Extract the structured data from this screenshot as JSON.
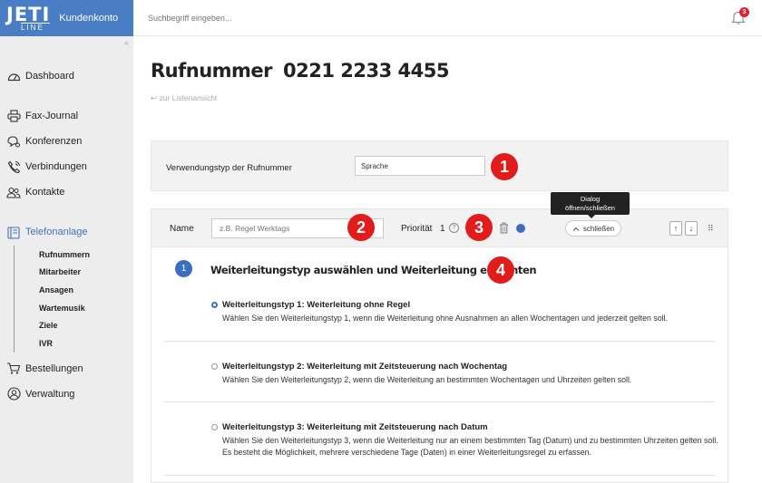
{
  "brand": {
    "logo_main": "JETI",
    "logo_sub": "LINE",
    "title": "Kundenkonto"
  },
  "search": {
    "placeholder": "Suchbegriff eingeben..."
  },
  "notifications": {
    "count": "3"
  },
  "nav": {
    "items": [
      {
        "label": "Dashboard",
        "icon": "dashboard-icon"
      },
      {
        "label": "Fax-Journal",
        "icon": "printer-icon"
      },
      {
        "label": "Konferenzen",
        "icon": "conference-icon"
      },
      {
        "label": "Verbindungen",
        "icon": "phone-icon"
      },
      {
        "label": "Kontakte",
        "icon": "contacts-icon"
      },
      {
        "label": "Telefonanlage",
        "icon": "pbx-icon"
      },
      {
        "label": "Bestellungen",
        "icon": "cart-icon"
      },
      {
        "label": "Verwaltung",
        "icon": "user-icon"
      }
    ],
    "sub_items": [
      "Rufnummern",
      "Mitarbeiter",
      "Ansagen",
      "Wartemusik",
      "Ziele",
      "IVR"
    ]
  },
  "page": {
    "title": "Rufnummer",
    "number": "0221 2233 4455",
    "back_link": "zur Listenansicht"
  },
  "usage": {
    "label": "Verwendungstyp der Rufnummer",
    "value": "Sprache"
  },
  "rule": {
    "name_label": "Name",
    "name_placeholder": "z.B. Regel Werktags",
    "priority_label": "Priorität",
    "priority_value": "1",
    "close_label": "schließen",
    "tooltip_line1": "Dialog",
    "tooltip_line2": "öffnen/schließen"
  },
  "markers": [
    "1",
    "2",
    "3",
    "4"
  ],
  "step": {
    "number": "1",
    "title": "Weiterleitungstyp auswählen und Weiterleitung einrichten"
  },
  "options": [
    {
      "title": "Weiterleitungstyp 1: Weiterleitung ohne Regel",
      "desc": "Wählen Sie den Weiterleitungstyp 1, wenn die Weiterleitung ohne Ausnahmen an allen Wochentagen und jederzeit gelten soll.",
      "selected": true
    },
    {
      "title": "Weiterleitungstyp 2: Weiterleitung mit Zeitsteuerung nach Wochentag",
      "desc": "Wählen Sie den Weiterleitungstyp 2, wenn die Weiterleitung an bestimmten Wochentagen und Uhrzeiten gelten soll.",
      "selected": false
    },
    {
      "title": "Weiterleitungstyp 3: Weiterleitung mit Zeitsteuerung nach Datum",
      "desc": "Wählen Sie den Weiterleitungstyp 3, wenn die Weiterleitung nur an einem bestimmten Tag (Datum) und zu bestimmten Uhrzeiten gelten soll. Es besteht die Möglichkeit, mehrere verschiedene Tage (Daten) in einer Weiterleitungsregel zu erfassen.",
      "selected": false
    }
  ],
  "colors": {
    "accent": "#3a6fc0",
    "brand": "#4a7ec4",
    "marker": "#e21b1b"
  }
}
